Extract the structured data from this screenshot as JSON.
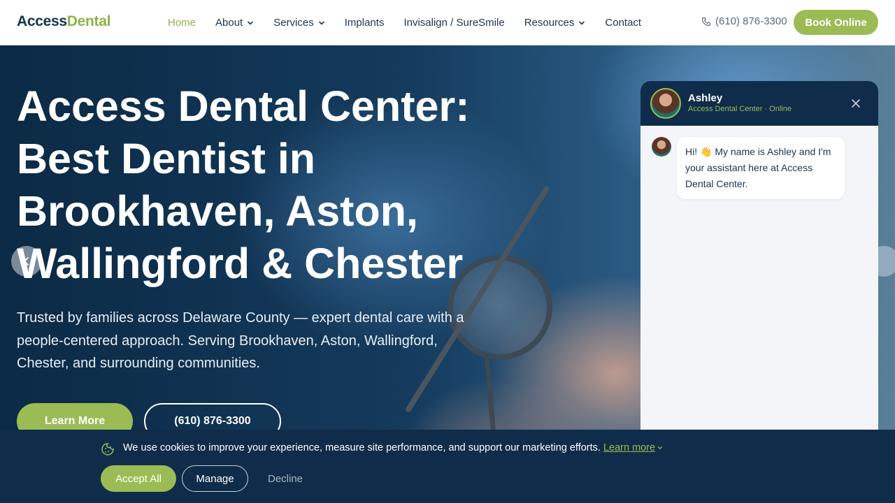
{
  "header": {
    "logo_part1": "Access",
    "logo_part2": "Dental",
    "nav": [
      {
        "label": "Home",
        "active": true,
        "has_dropdown": false
      },
      {
        "label": "About",
        "active": false,
        "has_dropdown": true
      },
      {
        "label": "Services",
        "active": false,
        "has_dropdown": true
      },
      {
        "label": "Implants",
        "active": false,
        "has_dropdown": false
      },
      {
        "label": "Invisalign / SureSmile",
        "active": false,
        "has_dropdown": false
      },
      {
        "label": "Resources",
        "active": false,
        "has_dropdown": true
      },
      {
        "label": "Contact",
        "active": false,
        "has_dropdown": false
      }
    ],
    "phone": "(610) 876-3300",
    "book_label": "Book Online"
  },
  "hero": {
    "title": "Access Dental Center: Best Dentist in Brookhaven, Aston, Wallingford & Chester",
    "subtitle": "Trusted by families across Delaware County — expert dental care with a people-centered approach. Serving Brookhaven, Aston, Wallingford, Chester, and surrounding communities.",
    "learn_more_label": "Learn More",
    "phone_button_label": "(610) 876-3300"
  },
  "chat": {
    "agent_name": "Ashley",
    "status": "Access Dental Center · Online",
    "message": "Hi! 👋 My name is Ashley and I'm your assistant here at Access Dental Center."
  },
  "cookie": {
    "text": "We use cookies to improve your experience, measure site performance, and support our marketing efforts.",
    "learn_more": "Learn more",
    "accept_label": "Accept All",
    "manage_label": "Manage",
    "decline_label": "Decline"
  },
  "colors": {
    "brand_navy": "#0f2d4a",
    "brand_green": "#9bbc55",
    "active_nav": "#8fb24a"
  },
  "icons": [
    "phone-icon",
    "chevron-down-icon",
    "chevron-left-icon",
    "close-icon",
    "cookie-icon"
  ]
}
